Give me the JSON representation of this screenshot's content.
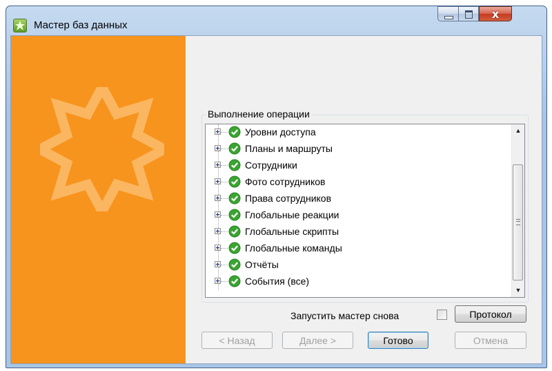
{
  "window": {
    "title": "Мастер баз данных",
    "close_glyph": "x"
  },
  "colors": {
    "side_panel": "#f7941d",
    "success_icon": "#3aa531"
  },
  "icons": {
    "app": "wizard-app-icon",
    "item_status": "green-check-circle-icon",
    "expand": "plus-box-icon"
  },
  "group": {
    "label": "Выполнение операции"
  },
  "tree": {
    "items": [
      {
        "label": "Уровни доступа"
      },
      {
        "label": "Планы и маршруты"
      },
      {
        "label": "Сотрудники"
      },
      {
        "label": "Фото сотрудников"
      },
      {
        "label": "Права сотрудников"
      },
      {
        "label": "Глобальные реакции"
      },
      {
        "label": "Глобальные скрипты"
      },
      {
        "label": "Глобальные команды"
      },
      {
        "label": "Отчёты"
      },
      {
        "label": "События (все)"
      }
    ]
  },
  "options": {
    "rerun_label": "Запустить мастер снова",
    "rerun_checked": false
  },
  "buttons": {
    "log": "Протокол",
    "back": "< Назад",
    "next": "Далее >",
    "finish": "Готово",
    "cancel": "Отмена"
  }
}
